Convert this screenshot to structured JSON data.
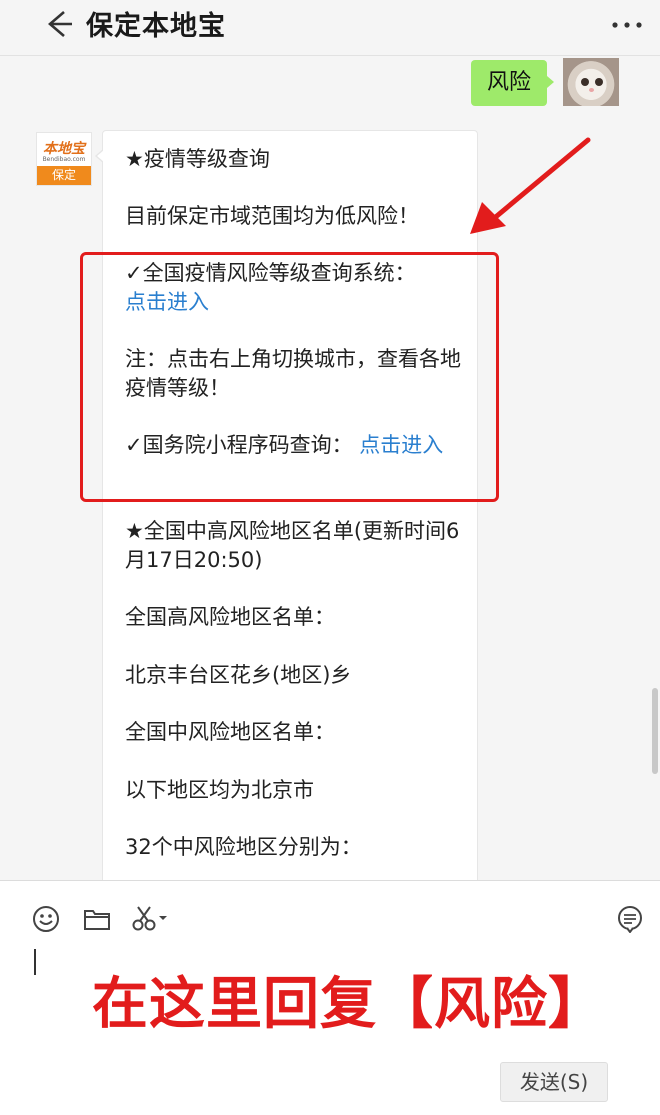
{
  "header": {
    "title": "保定本地宝"
  },
  "chat": {
    "sent_message": "风险",
    "bot_avatar": {
      "logo_text": "本地宝",
      "logo_sub": "Bendibao.com",
      "city": "保定"
    },
    "reply": {
      "line1": "★疫情等级查询",
      "line2": "目前保定市域范围均为低风险！",
      "line3": "✓全国疫情风险等级查询系统：",
      "link1": "点击进入",
      "line4": "注：点击右上角切换城市，查看各地疫情等级！",
      "line5_prefix": "✓国务院小程序码查询：",
      "link2": "点击进入",
      "line6": "★全国中高风险地区名单(更新时间6月17日20:50)",
      "line7": "全国高风险地区名单：",
      "line8": "北京丰台区花乡(地区)乡",
      "line9": "全国中风险地区名单：",
      "line10": "以下地区均为北京市",
      "line11": "32个中风险地区分别为："
    }
  },
  "input": {
    "reply_hint": "在这里回复【风险】",
    "send_label": "发送(S)"
  },
  "icons": {
    "back": "back-arrow-icon",
    "more": "more-dots-icon",
    "emoji": "emoji-icon",
    "folder": "folder-icon",
    "scissors": "scissors-icon",
    "chat_history": "chat-history-icon"
  },
  "colors": {
    "sent_bubble": "#9eea6a",
    "link": "#2a7fcf",
    "highlight": "#e21c1c",
    "logo_orange": "#f08a1c"
  }
}
